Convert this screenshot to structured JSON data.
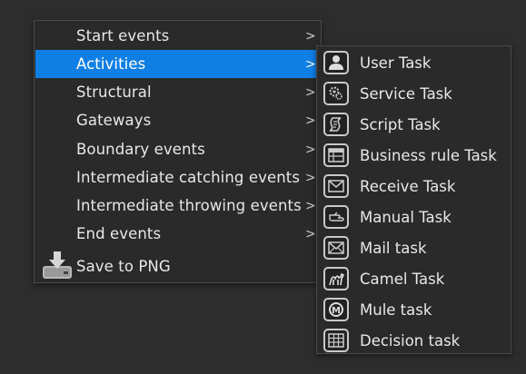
{
  "menu": {
    "items": [
      {
        "label": "Start events",
        "chevron": ">"
      },
      {
        "label": "Activities",
        "chevron": ">"
      },
      {
        "label": "Structural",
        "chevron": ">"
      },
      {
        "label": "Gateways",
        "chevron": ">"
      },
      {
        "label": "Boundary events",
        "chevron": ">"
      },
      {
        "label": "Intermediate catching events",
        "chevron": ">"
      },
      {
        "label": "Intermediate throwing events",
        "chevron": ">"
      },
      {
        "label": "End events",
        "chevron": ">"
      },
      {
        "label": "Save to PNG",
        "icon": "download-icon"
      }
    ],
    "active_index": 1,
    "active_color": "#0f7fe6"
  },
  "submenu": {
    "items": [
      {
        "label": "User Task",
        "icon": "user-icon"
      },
      {
        "label": "Service Task",
        "icon": "gear-icon"
      },
      {
        "label": "Script Task",
        "icon": "script-icon"
      },
      {
        "label": "Business rule Task",
        "icon": "table-icon"
      },
      {
        "label": "Receive Task",
        "icon": "envelope-icon"
      },
      {
        "label": "Manual Task",
        "icon": "hand-icon"
      },
      {
        "label": "Mail task",
        "icon": "envelope-icon"
      },
      {
        "label": "Camel Task",
        "icon": "camel-icon"
      },
      {
        "label": "Mule task",
        "icon": "mule-icon"
      },
      {
        "label": "Decision task",
        "icon": "grid-icon"
      }
    ]
  }
}
